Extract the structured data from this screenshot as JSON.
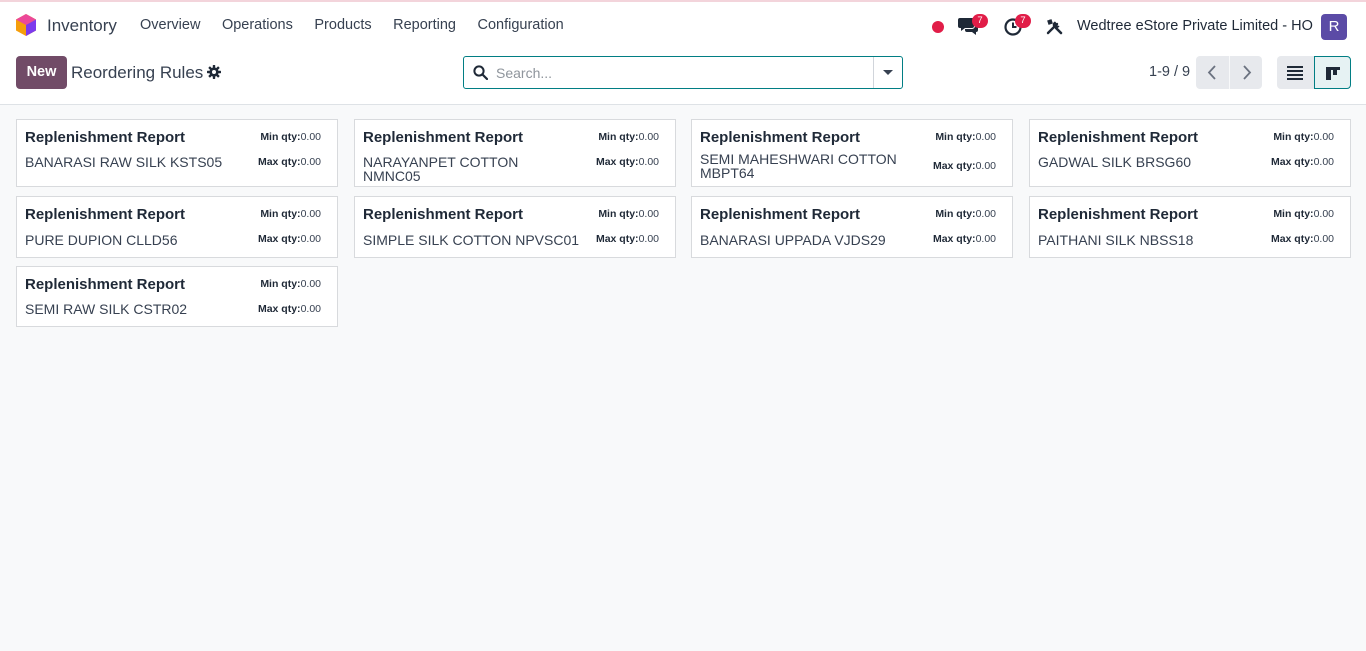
{
  "app": {
    "name": "Inventory"
  },
  "menu": [
    "Overview",
    "Operations",
    "Products",
    "Reporting",
    "Configuration"
  ],
  "systray": {
    "messages_count": "7",
    "activities_count": "7",
    "company": "Wedtree eStore Private Limited - HO",
    "avatar_initial": "R"
  },
  "control": {
    "new_label": "New",
    "title": "Reordering Rules",
    "search_placeholder": "Search...",
    "pager": "1-9 / 9"
  },
  "colors": {
    "brand": "#714b67",
    "accent": "#017e84",
    "badge": "#e11d48"
  },
  "cards": [
    {
      "title": "Replenishment Report",
      "product": "BANARASI RAW SILK KSTS05",
      "min_label": "Min qty:",
      "min": "0.00",
      "max_label": "Max qty:",
      "max": "0.00"
    },
    {
      "title": "Replenishment Report",
      "product": "NARAYANPET COTTON NMNC05",
      "min_label": "Min qty:",
      "min": "0.00",
      "max_label": "Max qty:",
      "max": "0.00"
    },
    {
      "title": "Replenishment Report",
      "product": "SEMI MAHESHWARI COTTON MBPT64",
      "min_label": "Min qty:",
      "min": "0.00",
      "max_label": "Max qty:",
      "max": "0.00"
    },
    {
      "title": "Replenishment Report",
      "product": "GADWAL SILK BRSG60",
      "min_label": "Min qty:",
      "min": "0.00",
      "max_label": "Max qty:",
      "max": "0.00"
    },
    {
      "title": "Replenishment Report",
      "product": "PURE DUPION CLLD56",
      "min_label": "Min qty:",
      "min": "0.00",
      "max_label": "Max qty:",
      "max": "0.00"
    },
    {
      "title": "Replenishment Report",
      "product": "SIMPLE SILK COTTON NPVSC01",
      "min_label": "Min qty:",
      "min": "0.00",
      "max_label": "Max qty:",
      "max": "0.00"
    },
    {
      "title": "Replenishment Report",
      "product": "BANARASI UPPADA VJDS29",
      "min_label": "Min qty:",
      "min": "0.00",
      "max_label": "Max qty:",
      "max": "0.00"
    },
    {
      "title": "Replenishment Report",
      "product": "PAITHANI SILK NBSS18",
      "min_label": "Min qty:",
      "min": "0.00",
      "max_label": "Max qty:",
      "max": "0.00"
    },
    {
      "title": "Replenishment Report",
      "product": "SEMI RAW SILK CSTR02",
      "min_label": "Min qty:",
      "min": "0.00",
      "max_label": "Max qty:",
      "max": "0.00"
    }
  ]
}
